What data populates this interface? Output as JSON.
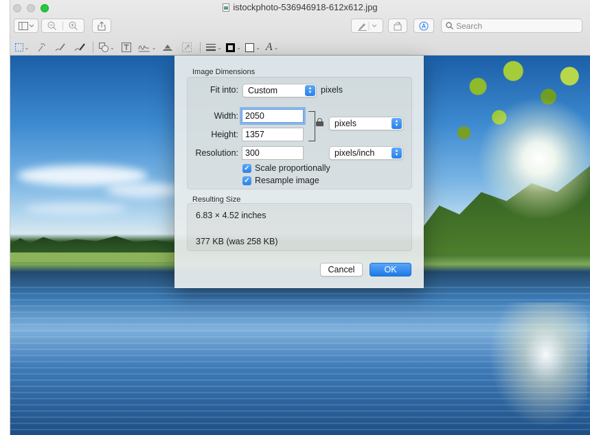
{
  "window": {
    "title": "istockphoto-536946918-612x612.jpg"
  },
  "toolbar": {
    "search_placeholder": "Search",
    "icons": [
      "sidebar-icon",
      "zoom-out-icon",
      "zoom-in-icon",
      "share-icon",
      "markup-pen-icon",
      "rotate-icon",
      "markup-toolbar-icon",
      "search-icon"
    ]
  },
  "markup_toolbar": {
    "tools": [
      "rectangular-selection-icon",
      "instant-alpha-icon",
      "sketch-icon",
      "draw-icon",
      "shapes-icon",
      "text-icon",
      "sign-icon",
      "adjust-color-icon",
      "adjust-size-icon",
      "shape-style-icon",
      "border-color-icon",
      "fill-color-icon",
      "text-style-icon"
    ],
    "text_style_glyph": "A"
  },
  "dialog": {
    "image_dimensions_label": "Image Dimensions",
    "fit_into_label": "Fit into:",
    "fit_into_value": "Custom",
    "fit_into_unit": "pixels",
    "width_label": "Width:",
    "width_value": "2050",
    "height_label": "Height:",
    "height_value": "1357",
    "dimension_unit": "pixels",
    "resolution_label": "Resolution:",
    "resolution_value": "300",
    "resolution_unit": "pixels/inch",
    "scale_proportionally_label": "Scale proportionally",
    "scale_proportionally_checked": true,
    "resample_label": "Resample image",
    "resample_checked": true,
    "resulting_size_label": "Resulting Size",
    "resulting_dimensions": "6.83 × 4.52 inches",
    "resulting_filesize": "377 KB (was 258 KB)",
    "cancel_label": "Cancel",
    "ok_label": "OK"
  },
  "colors": {
    "accent": "#2a80e6",
    "window_chrome": "#e4e4e4",
    "traffic_max": "#27c93f"
  }
}
